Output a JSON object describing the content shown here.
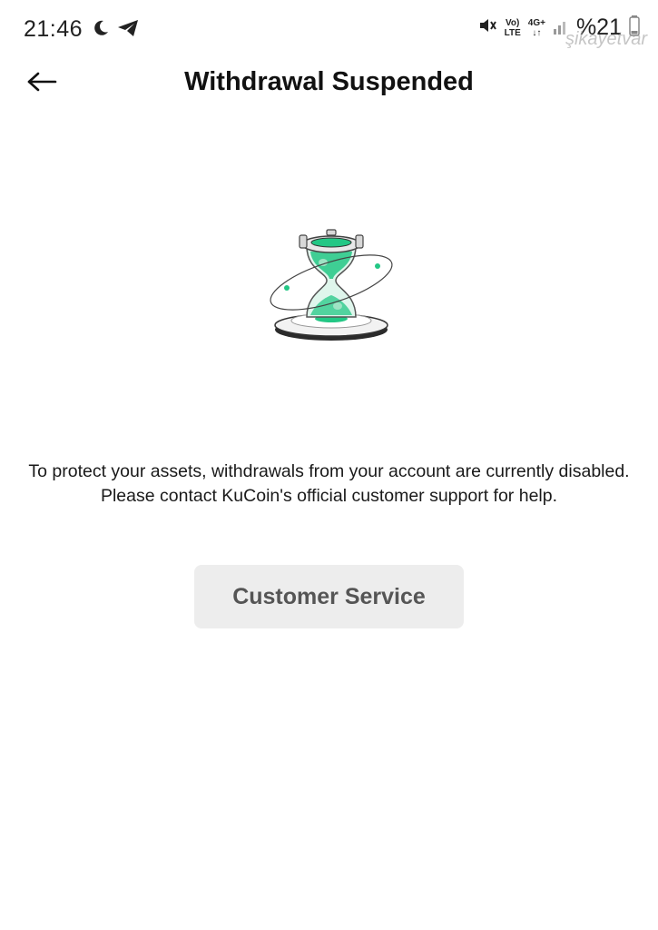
{
  "status_bar": {
    "time": "21:46",
    "net_vo": "Vo)",
    "net_lte": "LTE",
    "net_4g": "4G+",
    "net_arrows": "↓↑",
    "battery": "%21",
    "watermark": "şikayetvar"
  },
  "header": {
    "title": "Withdrawal Suspended"
  },
  "main": {
    "message": "To protect your assets, withdrawals from your account are currently disabled. Please contact KuCoin's official customer support for help.",
    "button_label": "Customer Service"
  },
  "colors": {
    "accent": "#23c785",
    "button_bg": "#ededed",
    "button_text": "#555555"
  }
}
